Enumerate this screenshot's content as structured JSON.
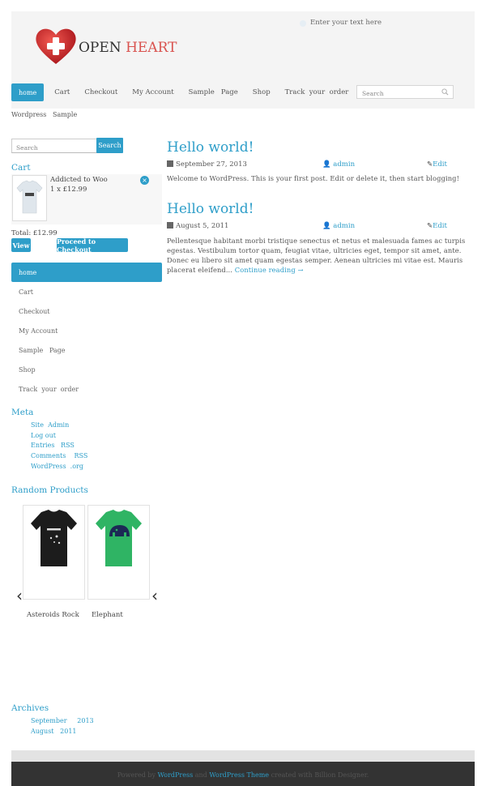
{
  "header": {
    "top_search_placeholder": "Enter your text here",
    "logo": {
      "word1": "OPEN",
      "word2": "HEART"
    }
  },
  "nav": {
    "items": [
      "home",
      "Cart",
      "Checkout",
      "My Account",
      "Sample   Page",
      "Shop",
      "Track  your  order"
    ],
    "active_index": 0,
    "search_placeholder": "Search"
  },
  "breadcrumb": "Wordpress   Sample",
  "sidebar": {
    "search_placeholder": "Search",
    "search_button": "Search",
    "cart": {
      "title": "Cart",
      "item_name": "Addicted to Woo",
      "item_qty": "1 x £12.99",
      "remove_glyph": "×",
      "total": "Total: £12.99",
      "view_button": "View",
      "checkout_button": "Proceed to Checkout"
    },
    "menu": [
      "home",
      "Cart",
      "Checkout",
      "My Account",
      "Sample   Page",
      "Shop",
      "Track  your  order"
    ],
    "meta": {
      "title": "Meta",
      "links": [
        "Site  Admin",
        "Log out",
        "Entries   RSS",
        "Comments    RSS",
        "WordPress  .org"
      ]
    },
    "random_products": {
      "title": "Random Products",
      "products": [
        "Asteroids Rock",
        "Elephant"
      ]
    },
    "archives": {
      "title": "Archives",
      "links": [
        "September     2013",
        "August   2011"
      ]
    }
  },
  "posts": [
    {
      "title": "Hello world!",
      "date": "September 27, 2013",
      "author": "admin",
      "edit": "Edit",
      "body": "Welcome to WordPress. This is your first post. Edit or delete it, then start blogging!",
      "more": ""
    },
    {
      "title": "Hello world!",
      "date": "August 5, 2011",
      "author": "admin",
      "edit": "Edit",
      "body": "Pellentesque habitant morbi tristique senectus et netus et malesuada fames ac turpis egestas. Vestibulum tortor quam, feugiat vitae, ultricies eget, tempor sit amet, ante. Donec eu libero sit amet quam egestas semper. Aenean ultricies mi vitae est. Mauris placerat eleifend...",
      "more": "Continue reading →"
    }
  ],
  "footer": {
    "prefix": "Powered by",
    "link1": "WordPress",
    "and": "and",
    "link2": "WordPress Theme",
    "suffix": "created with Billion Designer."
  },
  "colors": {
    "accent": "#2e9ec9",
    "logo_red": "#d9534f",
    "footer_bg": "#333333"
  }
}
